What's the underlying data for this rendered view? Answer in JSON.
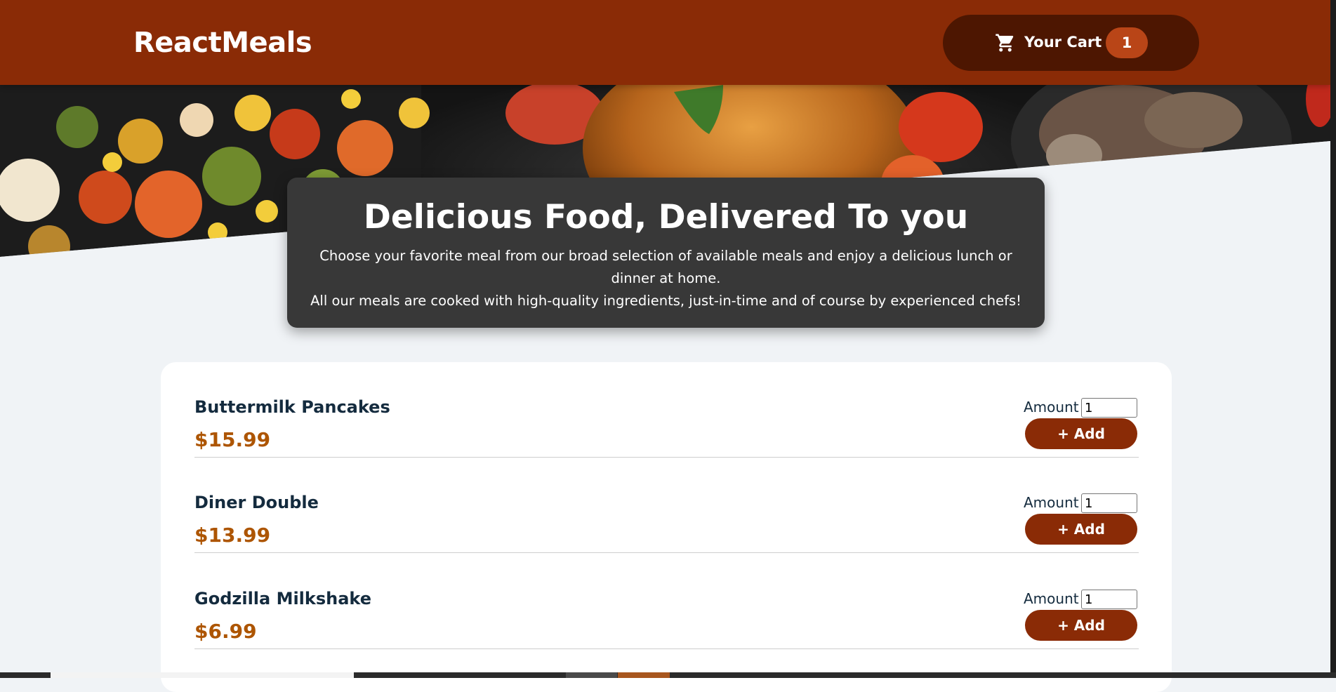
{
  "header": {
    "brand": "ReactMeals",
    "cart": {
      "label": "Your Cart",
      "count": "1",
      "icon": "cart-icon"
    }
  },
  "summary": {
    "title": "Delicious Food, Delivered To you",
    "line1": "Choose your favorite meal from our broad selection of available meals and enjoy a delicious lunch or dinner at home.",
    "line2": "All our meals are cooked with high-quality ingredients, just-in-time and of course by experienced chefs!"
  },
  "meals": [
    {
      "name": "Buttermilk Pancakes",
      "price": "$15.99",
      "amount_label": "Amount",
      "amount": "1",
      "add_label": "+ Add"
    },
    {
      "name": "Diner Double",
      "price": "$13.99",
      "amount_label": "Amount",
      "amount": "1",
      "add_label": "+ Add"
    },
    {
      "name": "Godzilla Milkshake",
      "price": "$6.99",
      "amount_label": "Amount",
      "amount": "1",
      "add_label": "+ Add"
    }
  ],
  "colors": {
    "header_bg": "#8a2b06",
    "cart_bg": "#4d1601",
    "badge_bg": "#b94517",
    "price": "#ad5502",
    "page_bg": "#f0f3f6"
  }
}
